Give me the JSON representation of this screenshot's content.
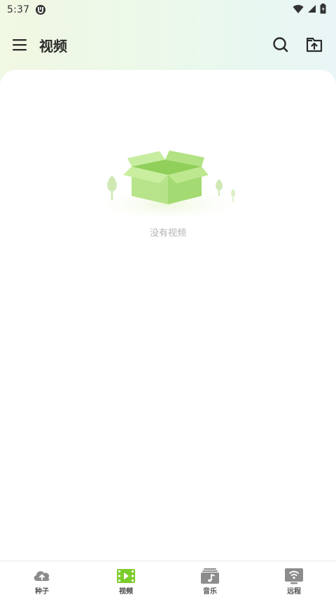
{
  "status_bar": {
    "time": "5:37"
  },
  "header": {
    "title": "视频"
  },
  "empty_state": {
    "message": "没有视频"
  },
  "bottom_nav": {
    "items": [
      {
        "label": "种子",
        "icon": "cloud-upload-icon",
        "active": false
      },
      {
        "label": "视频",
        "icon": "video-film-icon",
        "active": true
      },
      {
        "label": "音乐",
        "icon": "music-icon",
        "active": false
      },
      {
        "label": "远程",
        "icon": "remote-screen-icon",
        "active": false
      }
    ]
  },
  "colors": {
    "accent_green": "#7ccc2a",
    "icon_gray": "#8c8c8c",
    "title_text": "#2a2a2a",
    "empty_text": "#b3b3b3"
  }
}
